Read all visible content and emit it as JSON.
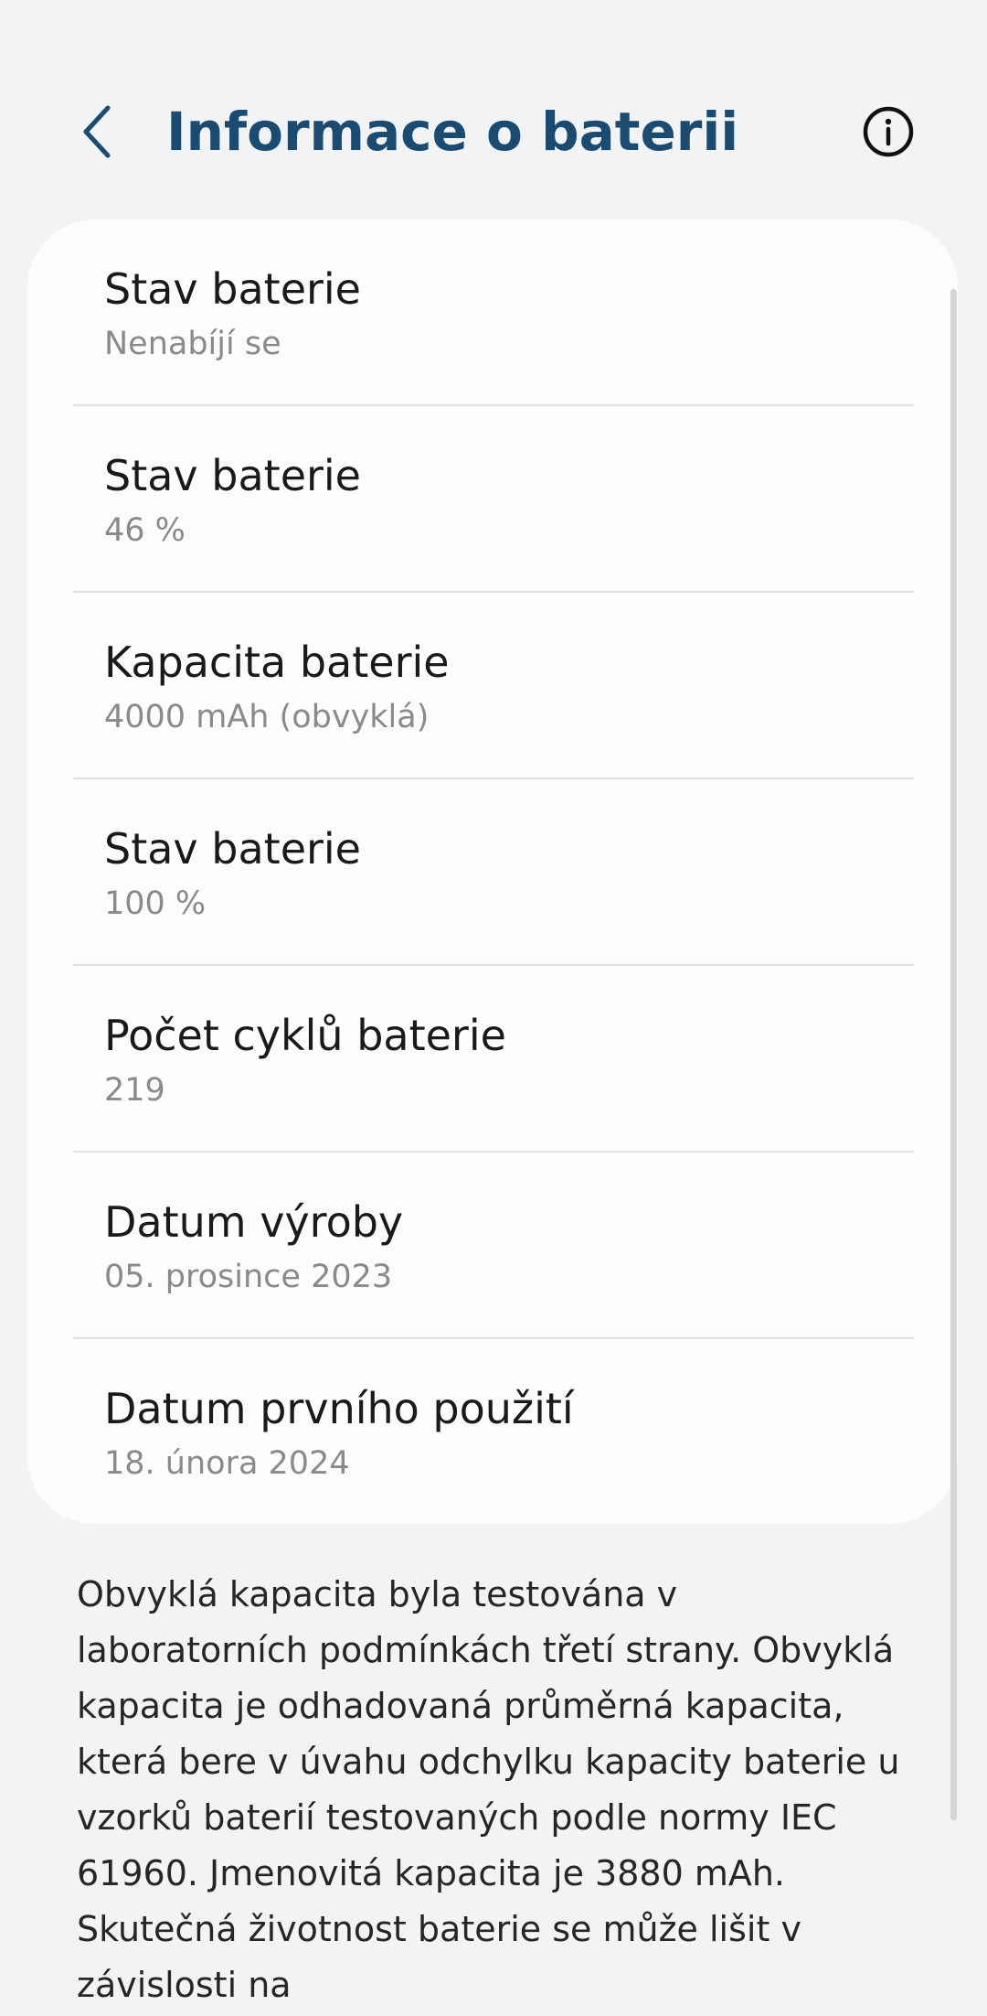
{
  "header": {
    "title": "Informace o baterii",
    "back_icon": "chevron-left-icon",
    "info_icon": "info-circle-icon"
  },
  "battery_info": {
    "items": [
      {
        "label": "Stav baterie",
        "value": "Nenabíjí se"
      },
      {
        "label": "Stav baterie",
        "value": "46 %"
      },
      {
        "label": "Kapacita baterie",
        "value": "4000 mAh (obvyklá)"
      },
      {
        "label": "Stav baterie",
        "value": "100 %"
      },
      {
        "label": "Počet cyklů baterie",
        "value": "219"
      },
      {
        "label": "Datum výroby",
        "value": "05. prosince 2023"
      },
      {
        "label": "Datum prvního použití",
        "value": "18. února 2024"
      }
    ]
  },
  "footnote": "Obvyklá kapacita byla testována v laboratorních podmínkách třetí strany. Obvyklá kapacita je odhadovaná průměrná kapacita, která bere v úvahu odchylku kapacity baterie u vzorků baterií testovaných podle normy IEC 61960. Jmenovitá kapacita je 3880 mAh. Skutečná životnost baterie se může lišit v závislosti na",
  "colors": {
    "title": "#1c4b72",
    "background": "#f2f3f5",
    "card": "#fcfcfc",
    "secondary_text": "#8a8a8a"
  }
}
